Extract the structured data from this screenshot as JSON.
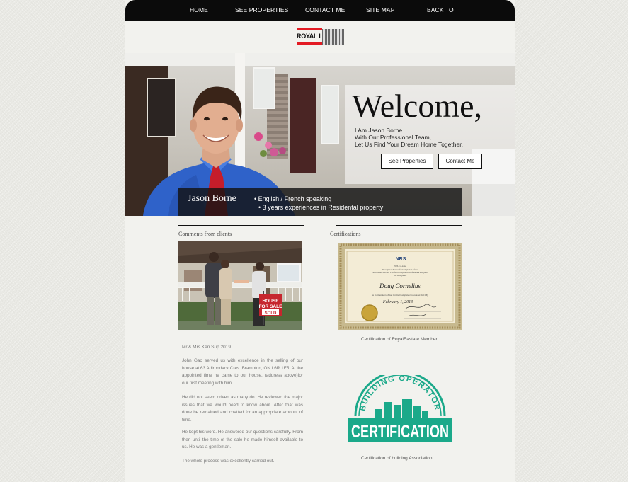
{
  "nav": {
    "items": [
      "HOME",
      "SEE PROPERTIES",
      "CONTACT ME",
      "SITE MAP",
      "BACK TO"
    ]
  },
  "logo": {
    "text": "ROYAL LePAGE",
    "icon": "royal-lepage-logo"
  },
  "hero": {
    "title": "Welcome,",
    "lines": [
      "I Am Jason Borne.",
      "With Our Professional Team,",
      "Let Us Find Your Dream Home Together."
    ],
    "buttons": {
      "properties": "See Properties",
      "contact": "Contact Me"
    },
    "agent_name": "Jason Borne",
    "bullets": [
      "English / French speaking",
      "3 years experiences in Residental property"
    ]
  },
  "comments": {
    "title": "Comments from clients",
    "sign": {
      "line1": "HOUSE",
      "line2": "FOR SALE",
      "line3": "SOLD"
    },
    "author": "Mr.& Mrs.Ken Sup.2019",
    "paragraphs": [
      "John Gao served us with excellence in the selling of our house at 63 Adirondack Cres.,Brampton, ON L6R 1E5. At the appointed time he came to our house, (address above)for our first meeting with him.",
      "He did not seem driven as many do. He reviewed the major issues that we would need to know about. After that was done he remained and chatted for an appropriate amount of time.",
      "He kept his word. He answered our questions carefully. From then until the time of the sale he made himself available to us. He was a gentleman.",
      "The whole process was excellently carried out."
    ]
  },
  "certifications": {
    "title": "Certifications",
    "cert1": {
      "org": "NRS",
      "text1": "NRS-Co-zone",
      "text2": "Recognizes Successful Completion of the",
      "text3": "Investment Advisor Certified Compliance Professional Program",
      "text4": "and Designates",
      "holder": "Doug Cornelius",
      "text5": "as an Investment Adviser Certified Compliance Professional (IACCP)",
      "date": "February 1, 2013",
      "caption": "Certification of RoyalEastate Member"
    },
    "cert2": {
      "arc_text": "BUILDING OPERATOR",
      "banner": "CERTIFICATION",
      "caption": "Certification of building Association"
    }
  },
  "colors": {
    "accent": "#e31b23",
    "nav_bg": "#0b0b0b",
    "bo_green": "#1ba98a"
  }
}
